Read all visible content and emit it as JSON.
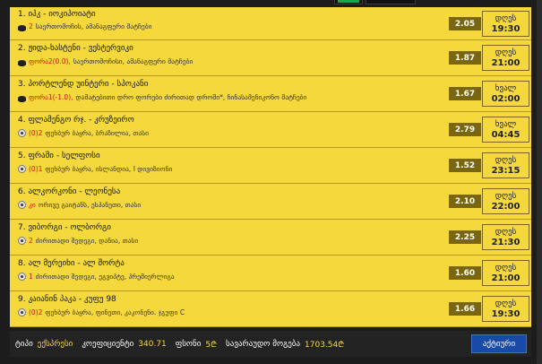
{
  "bets": [
    {
      "title": "1. იპკ - იოკიპოიატი",
      "sport_icon": "hockey-puck-icon",
      "pick": "2",
      "market": "საერთომოჩის, ამანაგფერი მატჩები",
      "odds": "2.05",
      "day": "დღეს",
      "time": "19:30"
    },
    {
      "title": "2. ჟიდა-ხასტენი - ვესტერვიკი",
      "sport_icon": "hockey-puck-icon",
      "pick": "ფორა2(0.0),",
      "market": "საერთომოჩისი, ამანაგფერი მატჩები",
      "odds": "1.87",
      "day": "დღეს",
      "time": "21:00"
    },
    {
      "title": "3. პორტლენდ უინტერი - სპოკანი",
      "sport_icon": "hockey-puck-icon",
      "pick": "ფორა1(-1.0),",
      "market": "დამატებითი დრო ფორები ძირითად დროში*, ჩინასამენიკონო მატჩები",
      "odds": "1.67",
      "day": "ხვალ",
      "time": "02:00"
    },
    {
      "title": "4. ფლამენგო რჯ. - კრუზეირო",
      "sport_icon": "football-icon",
      "pick": "(0)2",
      "market": "ფეხბურ ბაყრა, ბრაზილია, თასი",
      "odds": "2.79",
      "day": "ხვალ",
      "time": "04:45"
    },
    {
      "title": "5. ფრამი - სელფოსი",
      "sport_icon": "football-icon",
      "pick": "(0)1",
      "market": "ფეხბურ ბაყრა, ისლანდია, I დივიზიონი",
      "odds": "1.52",
      "day": "დღეს",
      "time": "23:15"
    },
    {
      "title": "6. ალკორკონი - ლეონესა",
      "sport_icon": "football-icon",
      "pick": "კი",
      "market": "ორივე გაიტანს, ესპანეთი, თასი",
      "odds": "2.10",
      "day": "დღეს",
      "time": "22:00"
    },
    {
      "title": "7. ვიბორგი - ოლბორგი",
      "sport_icon": "football-icon",
      "pick": "2",
      "market": "ძირითადი შედეგი, დანია, თასი",
      "odds": "2.25",
      "day": "დღეს",
      "time": "21:30"
    },
    {
      "title": "8. ალ მერეიხი - ალ შორტა",
      "sport_icon": "football-icon",
      "pick": "1",
      "market": "ძირითადი შედეგი, ეგვიპტე, პრემიერლიგა",
      "odds": "1.60",
      "day": "დღეს",
      "time": "21:00"
    },
    {
      "title": "9. კაიანინ პაკა - კუფუ 98",
      "sport_icon": "football-icon",
      "pick": "(0)2",
      "market": "ფეხბურ ბაყრა, ფინეთი, კაკონენი. ჯგუფი C",
      "odds": "1.66",
      "day": "დღეს",
      "time": "19:30"
    }
  ],
  "footer": {
    "type_label": "ტიპი",
    "type_value": "ექსპრესი",
    "coef_label": "კოეფიციენტი",
    "coef_value": "340.71",
    "stake_label": "ფსონი",
    "stake_value": "5₾",
    "win_label": "სავარაუდო მოგება",
    "win_value": "1703.54₾",
    "button_label": "აქტიური"
  },
  "colors": {
    "accent": "#f4d83c",
    "odds_bg": "#7a6510",
    "pick": "#d0111a",
    "button": "#1a4aa8"
  }
}
